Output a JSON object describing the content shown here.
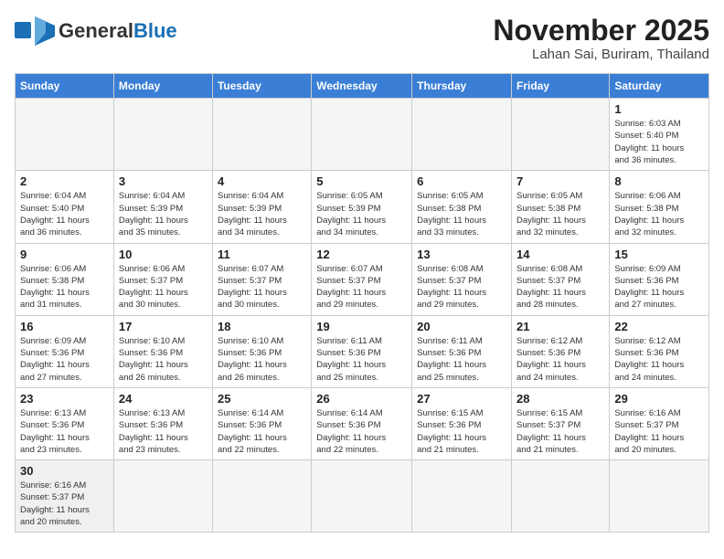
{
  "header": {
    "logo_general": "General",
    "logo_blue": "Blue",
    "month_title": "November 2025",
    "location": "Lahan Sai, Buriram, Thailand"
  },
  "weekdays": [
    "Sunday",
    "Monday",
    "Tuesday",
    "Wednesday",
    "Thursday",
    "Friday",
    "Saturday"
  ],
  "days": [
    {
      "date": "",
      "info": ""
    },
    {
      "date": "",
      "info": ""
    },
    {
      "date": "",
      "info": ""
    },
    {
      "date": "",
      "info": ""
    },
    {
      "date": "",
      "info": ""
    },
    {
      "date": "",
      "info": ""
    },
    {
      "date": "1",
      "info": "Sunrise: 6:03 AM\nSunset: 5:40 PM\nDaylight: 11 hours\nand 36 minutes."
    },
    {
      "date": "2",
      "info": "Sunrise: 6:04 AM\nSunset: 5:40 PM\nDaylight: 11 hours\nand 36 minutes."
    },
    {
      "date": "3",
      "info": "Sunrise: 6:04 AM\nSunset: 5:39 PM\nDaylight: 11 hours\nand 35 minutes."
    },
    {
      "date": "4",
      "info": "Sunrise: 6:04 AM\nSunset: 5:39 PM\nDaylight: 11 hours\nand 34 minutes."
    },
    {
      "date": "5",
      "info": "Sunrise: 6:05 AM\nSunset: 5:39 PM\nDaylight: 11 hours\nand 34 minutes."
    },
    {
      "date": "6",
      "info": "Sunrise: 6:05 AM\nSunset: 5:38 PM\nDaylight: 11 hours\nand 33 minutes."
    },
    {
      "date": "7",
      "info": "Sunrise: 6:05 AM\nSunset: 5:38 PM\nDaylight: 11 hours\nand 32 minutes."
    },
    {
      "date": "8",
      "info": "Sunrise: 6:06 AM\nSunset: 5:38 PM\nDaylight: 11 hours\nand 32 minutes."
    },
    {
      "date": "9",
      "info": "Sunrise: 6:06 AM\nSunset: 5:38 PM\nDaylight: 11 hours\nand 31 minutes."
    },
    {
      "date": "10",
      "info": "Sunrise: 6:06 AM\nSunset: 5:37 PM\nDaylight: 11 hours\nand 30 minutes."
    },
    {
      "date": "11",
      "info": "Sunrise: 6:07 AM\nSunset: 5:37 PM\nDaylight: 11 hours\nand 30 minutes."
    },
    {
      "date": "12",
      "info": "Sunrise: 6:07 AM\nSunset: 5:37 PM\nDaylight: 11 hours\nand 29 minutes."
    },
    {
      "date": "13",
      "info": "Sunrise: 6:08 AM\nSunset: 5:37 PM\nDaylight: 11 hours\nand 29 minutes."
    },
    {
      "date": "14",
      "info": "Sunrise: 6:08 AM\nSunset: 5:37 PM\nDaylight: 11 hours\nand 28 minutes."
    },
    {
      "date": "15",
      "info": "Sunrise: 6:09 AM\nSunset: 5:36 PM\nDaylight: 11 hours\nand 27 minutes."
    },
    {
      "date": "16",
      "info": "Sunrise: 6:09 AM\nSunset: 5:36 PM\nDaylight: 11 hours\nand 27 minutes."
    },
    {
      "date": "17",
      "info": "Sunrise: 6:10 AM\nSunset: 5:36 PM\nDaylight: 11 hours\nand 26 minutes."
    },
    {
      "date": "18",
      "info": "Sunrise: 6:10 AM\nSunset: 5:36 PM\nDaylight: 11 hours\nand 26 minutes."
    },
    {
      "date": "19",
      "info": "Sunrise: 6:11 AM\nSunset: 5:36 PM\nDaylight: 11 hours\nand 25 minutes."
    },
    {
      "date": "20",
      "info": "Sunrise: 6:11 AM\nSunset: 5:36 PM\nDaylight: 11 hours\nand 25 minutes."
    },
    {
      "date": "21",
      "info": "Sunrise: 6:12 AM\nSunset: 5:36 PM\nDaylight: 11 hours\nand 24 minutes."
    },
    {
      "date": "22",
      "info": "Sunrise: 6:12 AM\nSunset: 5:36 PM\nDaylight: 11 hours\nand 24 minutes."
    },
    {
      "date": "23",
      "info": "Sunrise: 6:13 AM\nSunset: 5:36 PM\nDaylight: 11 hours\nand 23 minutes."
    },
    {
      "date": "24",
      "info": "Sunrise: 6:13 AM\nSunset: 5:36 PM\nDaylight: 11 hours\nand 23 minutes."
    },
    {
      "date": "25",
      "info": "Sunrise: 6:14 AM\nSunset: 5:36 PM\nDaylight: 11 hours\nand 22 minutes."
    },
    {
      "date": "26",
      "info": "Sunrise: 6:14 AM\nSunset: 5:36 PM\nDaylight: 11 hours\nand 22 minutes."
    },
    {
      "date": "27",
      "info": "Sunrise: 6:15 AM\nSunset: 5:36 PM\nDaylight: 11 hours\nand 21 minutes."
    },
    {
      "date": "28",
      "info": "Sunrise: 6:15 AM\nSunset: 5:37 PM\nDaylight: 11 hours\nand 21 minutes."
    },
    {
      "date": "29",
      "info": "Sunrise: 6:16 AM\nSunset: 5:37 PM\nDaylight: 11 hours\nand 20 minutes."
    },
    {
      "date": "30",
      "info": "Sunrise: 6:16 AM\nSunset: 5:37 PM\nDaylight: 11 hours\nand 20 minutes."
    },
    {
      "date": "",
      "info": ""
    },
    {
      "date": "",
      "info": ""
    },
    {
      "date": "",
      "info": ""
    },
    {
      "date": "",
      "info": ""
    },
    {
      "date": "",
      "info": ""
    },
    {
      "date": "",
      "info": ""
    }
  ]
}
